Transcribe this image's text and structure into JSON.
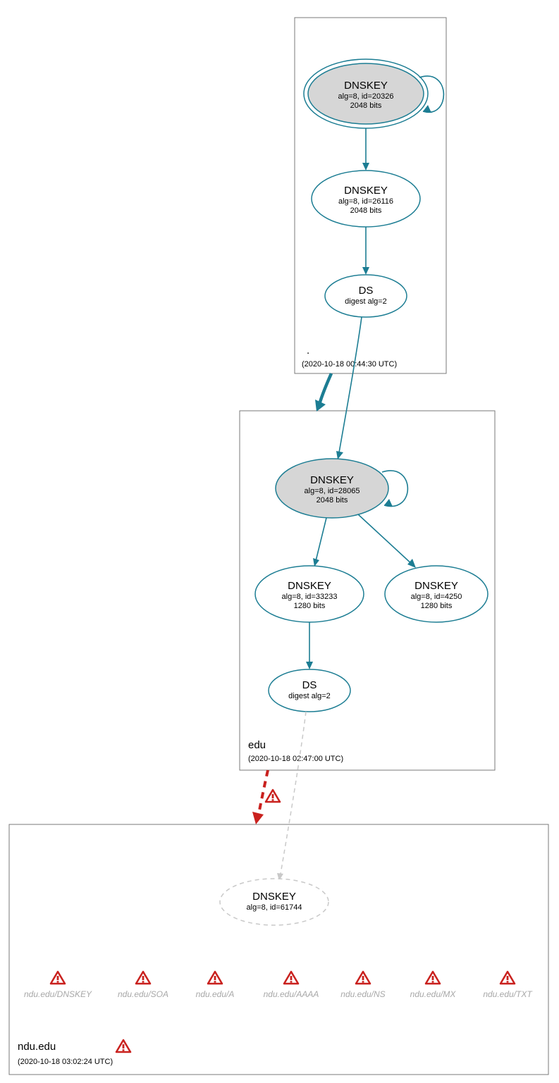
{
  "colors": {
    "teal": "#1c7d93",
    "red": "#c9211e",
    "gray": "#c9c9c9",
    "shaded": "#d6d6d6"
  },
  "zones": {
    "root": {
      "label": ".",
      "timestamp": "(2020-10-18 00:44:30 UTC)",
      "nodes": {
        "ksk": {
          "title": "DNSKEY",
          "line1": "alg=8, id=20326",
          "line2": "2048 bits"
        },
        "zsk": {
          "title": "DNSKEY",
          "line1": "alg=8, id=26116",
          "line2": "2048 bits"
        },
        "ds": {
          "title": "DS",
          "line1": "digest alg=2"
        }
      }
    },
    "edu": {
      "label": "edu",
      "timestamp": "(2020-10-18 02:47:00 UTC)",
      "nodes": {
        "ksk": {
          "title": "DNSKEY",
          "line1": "alg=8, id=28065",
          "line2": "2048 bits"
        },
        "zsk1": {
          "title": "DNSKEY",
          "line1": "alg=8, id=33233",
          "line2": "1280 bits"
        },
        "zsk2": {
          "title": "DNSKEY",
          "line1": "alg=8, id=4250",
          "line2": "1280 bits"
        },
        "ds": {
          "title": "DS",
          "line1": "digest alg=2"
        }
      }
    },
    "ndu": {
      "label": "ndu.edu",
      "timestamp": "(2020-10-18 03:02:24 UTC)",
      "nodes": {
        "key": {
          "title": "DNSKEY",
          "line1": "alg=8, id=61744"
        }
      },
      "rrsets": [
        "ndu.edu/DNSKEY",
        "ndu.edu/SOA",
        "ndu.edu/A",
        "ndu.edu/AAAA",
        "ndu.edu/NS",
        "ndu.edu/MX",
        "ndu.edu/TXT"
      ]
    }
  }
}
